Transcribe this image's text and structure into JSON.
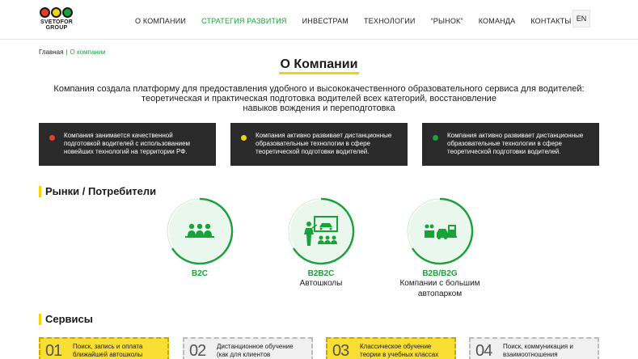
{
  "header": {
    "logo_text": "SVETOFOR GROUP",
    "logo_colors": [
      "#e53d2b",
      "#f2d40c",
      "#1aa23a"
    ],
    "nav": [
      {
        "label": "О КОМПАНИИ",
        "active": false
      },
      {
        "label": "СТРАТЕГИЯ РАЗВИТИЯ",
        "active": true
      },
      {
        "label": "ИНВЕСТРАМ",
        "active": false
      },
      {
        "label": "ТЕХНОЛОГИИ",
        "active": false
      },
      {
        "label": "“РЫНОК”",
        "active": false
      },
      {
        "label": "КОМАНДА",
        "active": false
      },
      {
        "label": "КОНТАКТЫ",
        "active": false
      }
    ],
    "lang": "EN"
  },
  "breadcrumb": {
    "home": "Главная",
    "current": "О компании"
  },
  "page": {
    "title": "О Компании",
    "intro_lines": [
      "Компания создала платформу для предоставления удобного и высококачественного образовательного сервиса для водителей:",
      "теоретическая и практическая подготовка водителей всех категорий, восстановление",
      "навыков вождения и переподготовка"
    ]
  },
  "cards": [
    {
      "dot_color": "#e53d2b",
      "lines": [
        "Компания занимается качественной",
        "подготовкой водителей с использованием",
        "новейших технологий на территории РФ."
      ]
    },
    {
      "dot_color": "#f2d40c",
      "lines": [
        "Компания активно развивает дистанционные",
        "образовательные технологии в сфере",
        "теоретической подготовки водителей."
      ]
    },
    {
      "dot_color": "#1aa23a",
      "lines": [
        "Компания активно развивает дистанционные",
        "образовательные технологии в сфере",
        "теоретической подготовки водителей."
      ]
    }
  ],
  "markets": {
    "title": "Рынки / Потребители",
    "items": [
      {
        "label": "B2C",
        "sub": [],
        "icon": "people-group-icon"
      },
      {
        "label": "B2B2C",
        "sub": [
          "Автошколы"
        ],
        "icon": "classroom-icon"
      },
      {
        "label": "B2B/B2G",
        "sub": [
          "Компании с большим",
          "автопарком"
        ],
        "icon": "fleet-icon"
      }
    ]
  },
  "services": {
    "title": "Сервисы",
    "items": [
      {
        "num": "01",
        "lines": [
          "Поиск, запись и оплата",
          "ближайшей автошколы"
        ],
        "highlight": true
      },
      {
        "num": "02",
        "lines": [
          "Дистанционное обучение",
          "(как для клиентов"
        ],
        "highlight": false
      },
      {
        "num": "03",
        "lines": [
          "Классическое обучение",
          "теории в учебных классах"
        ],
        "highlight": true
      },
      {
        "num": "04",
        "lines": [
          "Поиск, коммуникация и",
          "взаимоотношения"
        ],
        "highlight": false
      }
    ]
  },
  "colors": {
    "accent_green": "#1aa23a",
    "accent_yellow": "#f2d40c",
    "dark_card": "#2a2a2a"
  }
}
